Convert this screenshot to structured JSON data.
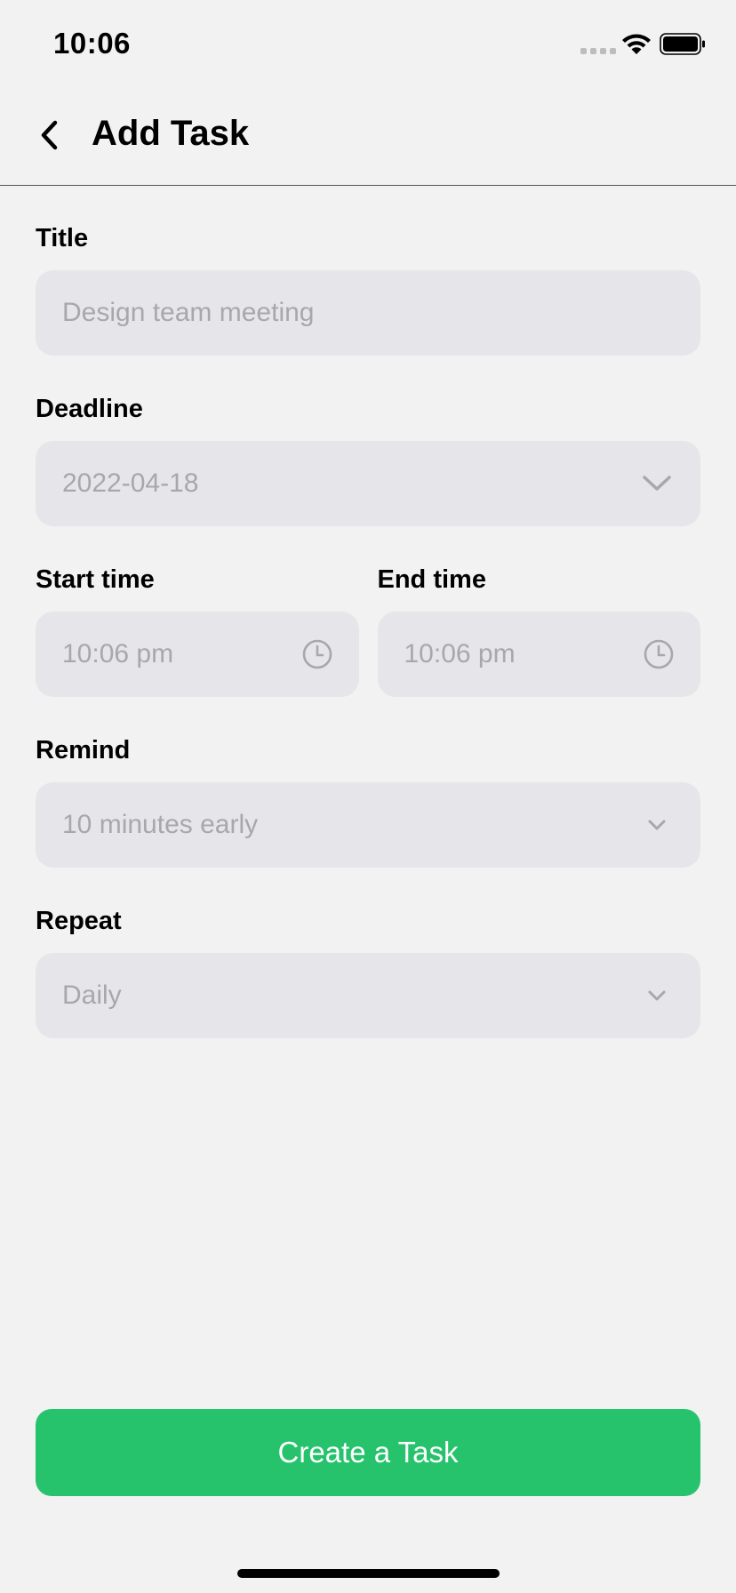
{
  "status_bar": {
    "time": "10:06"
  },
  "header": {
    "title": "Add Task",
    "back_icon": "chevron-left-icon"
  },
  "form": {
    "title": {
      "label": "Title",
      "value": "Design team meeting"
    },
    "deadline": {
      "label": "Deadline",
      "value": "2022-04-18",
      "icon": "chevron-down-icon"
    },
    "start_time": {
      "label": "Start time",
      "value": "10:06 pm",
      "icon": "clock-icon"
    },
    "end_time": {
      "label": "End time",
      "value": "10:06 pm",
      "icon": "clock-icon"
    },
    "remind": {
      "label": "Remind",
      "value": "10 minutes early",
      "icon": "chevron-down-icon"
    },
    "repeat": {
      "label": "Repeat",
      "value": "Daily",
      "icon": "chevron-down-icon"
    }
  },
  "actions": {
    "create_label": "Create a Task"
  },
  "colors": {
    "accent": "#27c26c",
    "background": "#f2f2f2",
    "field_background": "#e6e6ea",
    "placeholder_text": "#a7a7ac"
  }
}
